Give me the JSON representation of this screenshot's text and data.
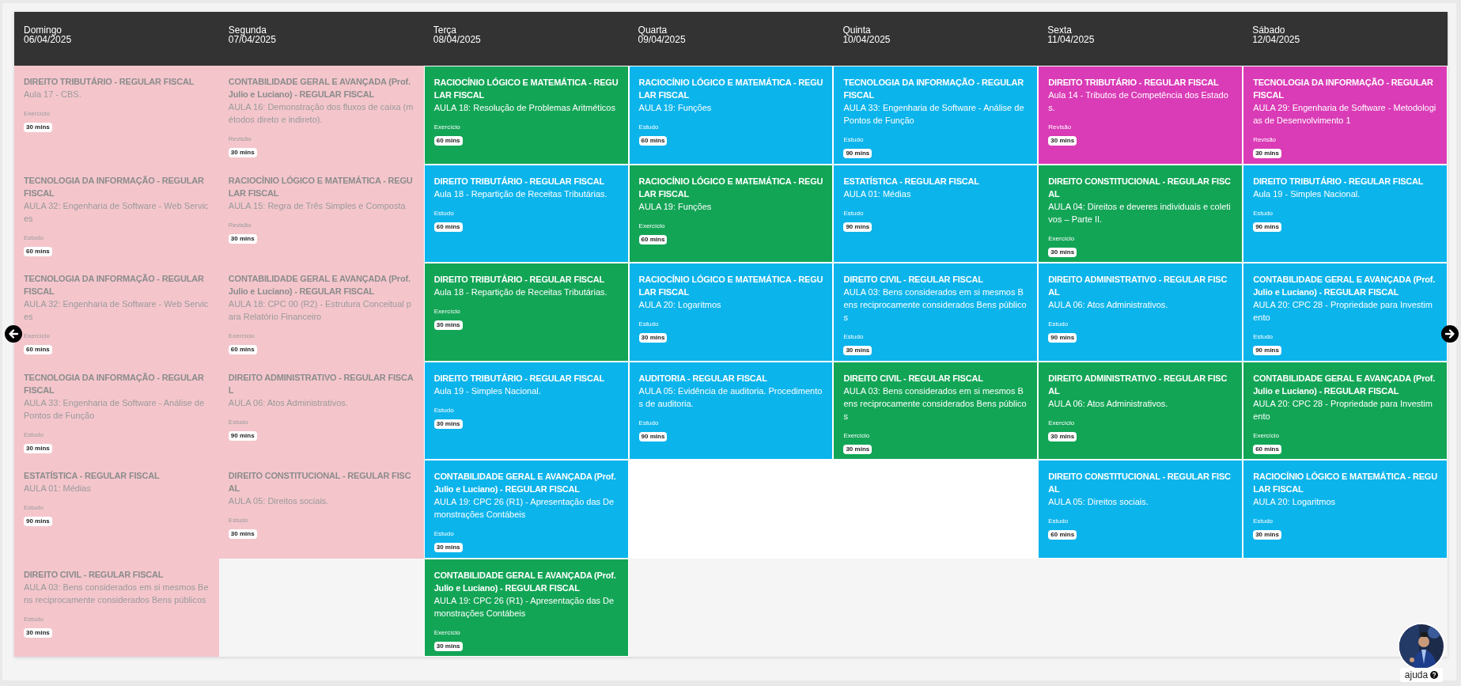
{
  "days": [
    {
      "weekday": "Domingo",
      "date": "06/04/2025",
      "past": true,
      "cards": [
        {
          "subject": "DIREITO TRIBUTÁRIO - REGULAR FISCAL",
          "lesson": "Aula 17 - CBS.",
          "type": "Exercício",
          "duration": "30 mins"
        },
        {
          "subject": "TECNOLOGIA DA INFORMAÇÃO - REGULAR FISCAL",
          "lesson": "AULA 32: Engenharia de Software - Web Services",
          "type": "Estudo",
          "duration": "60 mins"
        },
        {
          "subject": "TECNOLOGIA DA INFORMAÇÃO - REGULAR FISCAL",
          "lesson": "AULA 32: Engenharia de Software - Web Services",
          "type": "Exercício",
          "duration": "60 mins"
        },
        {
          "subject": "TECNOLOGIA DA INFORMAÇÃO - REGULAR FISCAL",
          "lesson": "AULA 33: Engenharia de Software - Análise de Pontos de Função",
          "type": "Estudo",
          "duration": "30 mins"
        },
        {
          "subject": "ESTATÍSTICA - REGULAR FISCAL",
          "lesson": "AULA 01: Médias",
          "type": "Estudo",
          "duration": "90 mins"
        },
        {
          "subject": "DIREITO CIVIL - REGULAR FISCAL",
          "lesson": "AULA 03: Bens considerados em si mesmos Bens reciprocamente considerados Bens públicos",
          "type": "Estudo",
          "duration": "30 mins"
        }
      ]
    },
    {
      "weekday": "Segunda",
      "date": "07/04/2025",
      "past": true,
      "cards": [
        {
          "subject": "CONTABILIDADE GERAL E AVANÇADA (Prof. Julio e Luciano) - REGULAR FISCAL",
          "lesson": "AULA 16: Demonstração dos fluxos de caixa (métodos direto e indireto).",
          "type": "Revisão",
          "duration": "30 mins"
        },
        {
          "subject": "RACIOCÍNIO LÓGICO E MATEMÁTICA - REGULAR FISCAL",
          "lesson": "AULA 15: Regra de Três Simples e Composta",
          "type": "Revisão",
          "duration": "30 mins"
        },
        {
          "subject": "CONTABILIDADE GERAL E AVANÇADA (Prof. Julio e Luciano) - REGULAR FISCAL",
          "lesson": "AULA 18: CPC 00 (R2) - Estrutura Conceitual para Relatório Financeiro",
          "type": "Exercício",
          "duration": "60 mins"
        },
        {
          "subject": "DIREITO ADMINISTRATIVO - REGULAR FISCAL",
          "lesson": "AULA 06: Atos Administrativos.",
          "type": "Estudo",
          "duration": "90 mins"
        },
        {
          "subject": "DIREITO CONSTITUCIONAL - REGULAR FISCAL",
          "lesson": "AULA 05: Direitos sociais.",
          "type": "Estudo",
          "duration": "30 mins"
        }
      ]
    },
    {
      "weekday": "Terça",
      "date": "08/04/2025",
      "past": false,
      "cards": [
        {
          "subject": "RACIOCÍNIO LÓGICO E MATEMÁTICA - REGULAR FISCAL",
          "lesson": "AULA 18: Resolução de Problemas Aritméticos",
          "type": "Exercício",
          "duration": "60 mins",
          "color": "#13a556"
        },
        {
          "subject": "DIREITO TRIBUTÁRIO - REGULAR FISCAL",
          "lesson": "Aula 18 - Repartição de Receitas Tributárias.",
          "type": "Estudo",
          "duration": "60 mins",
          "color": "#0cb4ec"
        },
        {
          "subject": "DIREITO TRIBUTÁRIO - REGULAR FISCAL",
          "lesson": "Aula 18 - Repartição de Receitas Tributárias.",
          "type": "Exercício",
          "duration": "30 mins",
          "color": "#13a556"
        },
        {
          "subject": "DIREITO TRIBUTÁRIO - REGULAR FISCAL",
          "lesson": "Aula 19 - Simples Nacional.",
          "type": "Estudo",
          "duration": "30 mins",
          "color": "#0cb4ec"
        },
        {
          "subject": "CONTABILIDADE GERAL E AVANÇADA (Prof. Julio e Luciano) - REGULAR FISCAL",
          "lesson": "AULA 19: CPC 26 (R1) - Apresentação das Demonstrações Contábeis",
          "type": "Estudo",
          "duration": "30 mins",
          "color": "#0cb4ec"
        },
        {
          "subject": "CONTABILIDADE GERAL E AVANÇADA (Prof. Julio e Luciano) - REGULAR FISCAL",
          "lesson": "AULA 19: CPC 26 (R1) - Apresentação das Demonstrações Contábeis",
          "type": "Exercício",
          "duration": "30 mins",
          "color": "#13a556"
        }
      ]
    },
    {
      "weekday": "Quarta",
      "date": "09/04/2025",
      "past": false,
      "cards": [
        {
          "subject": "RACIOCÍNIO LÓGICO E MATEMÁTICA - REGULAR FISCAL",
          "lesson": "AULA 19: Funções",
          "type": "Estudo",
          "duration": "60 mins",
          "color": "#0cb4ec"
        },
        {
          "subject": "RACIOCÍNIO LÓGICO E MATEMÁTICA - REGULAR FISCAL",
          "lesson": "AULA 19: Funções",
          "type": "Exercício",
          "duration": "60 mins",
          "color": "#13a556"
        },
        {
          "subject": "RACIOCÍNIO LÓGICO E MATEMÁTICA - REGULAR FISCAL",
          "lesson": "AULA 20: Logaritmos",
          "type": "Estudo",
          "duration": "30 mins",
          "color": "#0cb4ec"
        },
        {
          "subject": "AUDITORIA - REGULAR FISCAL",
          "lesson": "AULA 05: Evidência de auditoria. Procedimentos de auditoria.",
          "type": "Estudo",
          "duration": "90 mins",
          "color": "#0cb4ec"
        }
      ]
    },
    {
      "weekday": "Quinta",
      "date": "10/04/2025",
      "past": false,
      "cards": [
        {
          "subject": "TECNOLOGIA DA INFORMAÇÃO - REGULAR FISCAL",
          "lesson": "AULA 33: Engenharia de Software - Análise de Pontos de Função",
          "type": "Estudo",
          "duration": "90 mins",
          "color": "#0cb4ec"
        },
        {
          "subject": "ESTATÍSTICA - REGULAR FISCAL",
          "lesson": "AULA 01: Médias",
          "type": "Estudo",
          "duration": "90 mins",
          "color": "#0cb4ec"
        },
        {
          "subject": "DIREITO CIVIL - REGULAR FISCAL",
          "lesson": "AULA 03: Bens considerados em si mesmos Bens reciprocamente considerados Bens públicos",
          "type": "Estudo",
          "duration": "30 mins",
          "color": "#0cb4ec"
        },
        {
          "subject": "DIREITO CIVIL - REGULAR FISCAL",
          "lesson": "AULA 03: Bens considerados em si mesmos Bens reciprocamente considerados Bens públicos",
          "type": "Exercício",
          "duration": "30 mins",
          "color": "#13a556"
        }
      ]
    },
    {
      "weekday": "Sexta",
      "date": "11/04/2025",
      "past": false,
      "cards": [
        {
          "subject": "DIREITO TRIBUTÁRIO - REGULAR FISCAL",
          "lesson": "Aula 14 - Tributos de Competência dos Estados.",
          "type": "Revisão",
          "duration": "30 mins",
          "color": "#da3bb6"
        },
        {
          "subject": "DIREITO CONSTITUCIONAL - REGULAR FISCAL",
          "lesson": "AULA 04: Direitos e deveres individuais e coletivos – Parte II.",
          "type": "Exercício",
          "duration": "30 mins",
          "color": "#13a556"
        },
        {
          "subject": "DIREITO ADMINISTRATIVO - REGULAR FISCAL",
          "lesson": "AULA 06: Atos Administrativos.",
          "type": "Estudo",
          "duration": "90 mins",
          "color": "#0cb4ec"
        },
        {
          "subject": "DIREITO ADMINISTRATIVO - REGULAR FISCAL",
          "lesson": "AULA 06: Atos Administrativos.",
          "type": "Exercício",
          "duration": "30 mins",
          "color": "#13a556"
        },
        {
          "subject": "DIREITO CONSTITUCIONAL - REGULAR FISCAL",
          "lesson": "AULA 05: Direitos sociais.",
          "type": "Estudo",
          "duration": "60 mins",
          "color": "#0cb4ec"
        }
      ]
    },
    {
      "weekday": "Sábado",
      "date": "12/04/2025",
      "past": false,
      "cards": [
        {
          "subject": "TECNOLOGIA DA INFORMAÇÃO - REGULAR FISCAL",
          "lesson": "AULA 29: Engenharia de Software - Metodologias de Desenvolvimento 1",
          "type": "Revisão",
          "duration": "30 mins",
          "color": "#da3bb6"
        },
        {
          "subject": "DIREITO TRIBUTÁRIO - REGULAR FISCAL",
          "lesson": "Aula 19 - Simples Nacional.",
          "type": "Estudo",
          "duration": "90 mins",
          "color": "#0cb4ec"
        },
        {
          "subject": "CONTABILIDADE GERAL E AVANÇADA (Prof. Julio e Luciano) - REGULAR FISCAL",
          "lesson": "AULA 20: CPC 28 - Propriedade para Investimento",
          "type": "Estudo",
          "duration": "90 mins",
          "color": "#0cb4ec"
        },
        {
          "subject": "CONTABILIDADE GERAL E AVANÇADA (Prof. Julio e Luciano) - REGULAR FISCAL",
          "lesson": "AULA 20: CPC 28 - Propriedade para Investimento",
          "type": "Exercício",
          "duration": "60 mins",
          "color": "#13a556"
        },
        {
          "subject": "RACIOCÍNIO LÓGICO E MATEMÁTICA - REGULAR FISCAL",
          "lesson": "AULA 20: Logaritmos",
          "type": "Estudo",
          "duration": "30 mins",
          "color": "#0cb4ec"
        }
      ]
    }
  ],
  "help": {
    "label": "ajuda"
  }
}
